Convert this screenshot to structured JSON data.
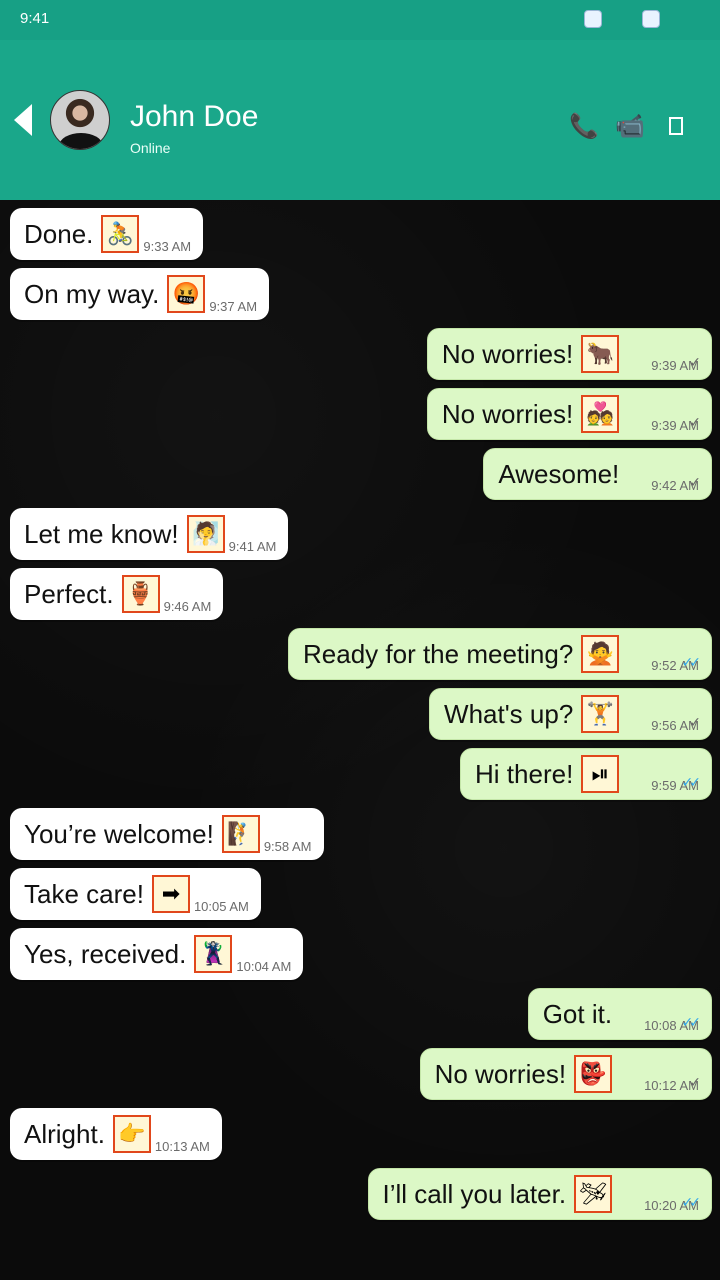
{
  "status_bar": {
    "time": "9:41"
  },
  "header": {
    "contact_name": "John Doe",
    "contact_status": "Online",
    "accent": "#1aa78a"
  },
  "messages": [
    {
      "dir": "in",
      "text": "Done.",
      "emoji": "🚴",
      "time": "9:33 AM"
    },
    {
      "dir": "in",
      "text": "On my way.",
      "emoji": "🤬",
      "time": "9:37 AM"
    },
    {
      "dir": "out",
      "text": "No worries!",
      "emoji": "🐂",
      "time": "9:39 AM",
      "status": "sent"
    },
    {
      "dir": "out",
      "text": "No worries!",
      "emoji": "💑",
      "time": "9:39 AM",
      "status": "sent"
    },
    {
      "dir": "out",
      "text": "Awesome!",
      "emoji": "",
      "time": "9:42 AM",
      "status": "sent"
    },
    {
      "dir": "in",
      "text": "Let me know!",
      "emoji": "🧖",
      "time": "9:41 AM"
    },
    {
      "dir": "in",
      "text": "Perfect.",
      "emoji": "🏺",
      "time": "9:46 AM"
    },
    {
      "dir": "out",
      "text": "Ready for the meeting?",
      "emoji": "🙅",
      "time": "9:52 AM",
      "status": "read"
    },
    {
      "dir": "out",
      "text": "What's up?",
      "emoji": "🏋",
      "time": "9:56 AM",
      "status": "sent"
    },
    {
      "dir": "out",
      "text": "Hi there!",
      "emoji": "⏯",
      "time": "9:59 AM",
      "status": "read"
    },
    {
      "dir": "in",
      "text": "You’re welcome!",
      "emoji": "🧗",
      "time": "9:58 AM"
    },
    {
      "dir": "in",
      "text": "Take care!",
      "emoji": "➡",
      "time": "10:05 AM"
    },
    {
      "dir": "in",
      "text": "Yes, received.",
      "emoji": "🦹",
      "time": "10:04 AM"
    },
    {
      "dir": "out",
      "text": "Got it.",
      "emoji": "",
      "time": "10:08 AM",
      "status": "read"
    },
    {
      "dir": "out",
      "text": "No worries!",
      "emoji": "👺",
      "time": "10:12 AM",
      "status": "sent"
    },
    {
      "dir": "in",
      "text": "Alright.",
      "emoji": "👉",
      "time": "10:13 AM"
    },
    {
      "dir": "out",
      "text": "I’ll call you later.",
      "emoji": "🛩",
      "time": "10:20 AM",
      "status": "read"
    }
  ]
}
